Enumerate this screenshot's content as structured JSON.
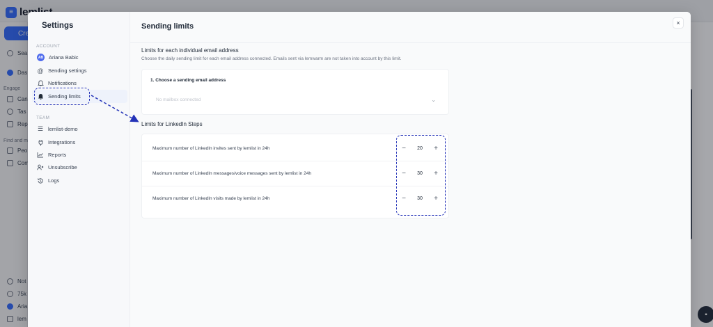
{
  "background": {
    "brand_name": "lemlist",
    "create_label": "Cre",
    "search_label": "Sea",
    "dashboard_label": "Das",
    "engage_heading": "Engage",
    "engage_items": [
      "Can",
      "Tas",
      "Rep"
    ],
    "find_heading": "Find and ma",
    "find_items": [
      "Peo",
      "Com"
    ],
    "bottom_items": [
      "Not",
      "75k",
      "Aria",
      "lem"
    ]
  },
  "settings": {
    "title": "Settings",
    "account_heading": "ACCOUNT",
    "account_items": [
      {
        "label": "Ariana Babic",
        "icon": "avatar-initials",
        "initials": "AB"
      },
      {
        "label": "Sending settings",
        "icon": "at-sign-icon"
      },
      {
        "label": "Notifications",
        "icon": "bell-icon"
      },
      {
        "label": "Sending limits",
        "icon": "bell-filled-icon",
        "active": true
      }
    ],
    "team_heading": "TEAM",
    "team_items": [
      {
        "label": "lemlist-demo",
        "icon": "list-icon"
      },
      {
        "label": "Integrations",
        "icon": "plug-icon"
      },
      {
        "label": "Reports",
        "icon": "chart-icon"
      },
      {
        "label": "Unsubscribe",
        "icon": "user-x-icon"
      },
      {
        "label": "Logs",
        "icon": "history-icon"
      }
    ]
  },
  "page": {
    "title": "Sending limits",
    "close_label": "×",
    "email_section": {
      "title": "Limits for each individual email address",
      "description": "Choose the daily sending limit for each email address connected. Emails sent via lemwarm are not taken into account by this limit.",
      "choose_label": "1. Choose a sending email address",
      "select_placeholder": "No mailbox connected"
    },
    "linkedin_section": {
      "title": "Limits for LinkedIn Steps",
      "rows": [
        {
          "label": "Maximum number of LinkedIn invites sent by lemlist in 24h",
          "value": "20"
        },
        {
          "label": "Maximum number of LinkedIn messages/voice messages sent by lemlist in 24h",
          "value": "30"
        },
        {
          "label": "Maximum number of LinkedIn visits made by lemlist in 24h",
          "value": "30"
        }
      ],
      "minus_label": "−",
      "plus_label": "+"
    }
  },
  "colors": {
    "accent": "#316bff",
    "annotation": "#2433b8"
  }
}
